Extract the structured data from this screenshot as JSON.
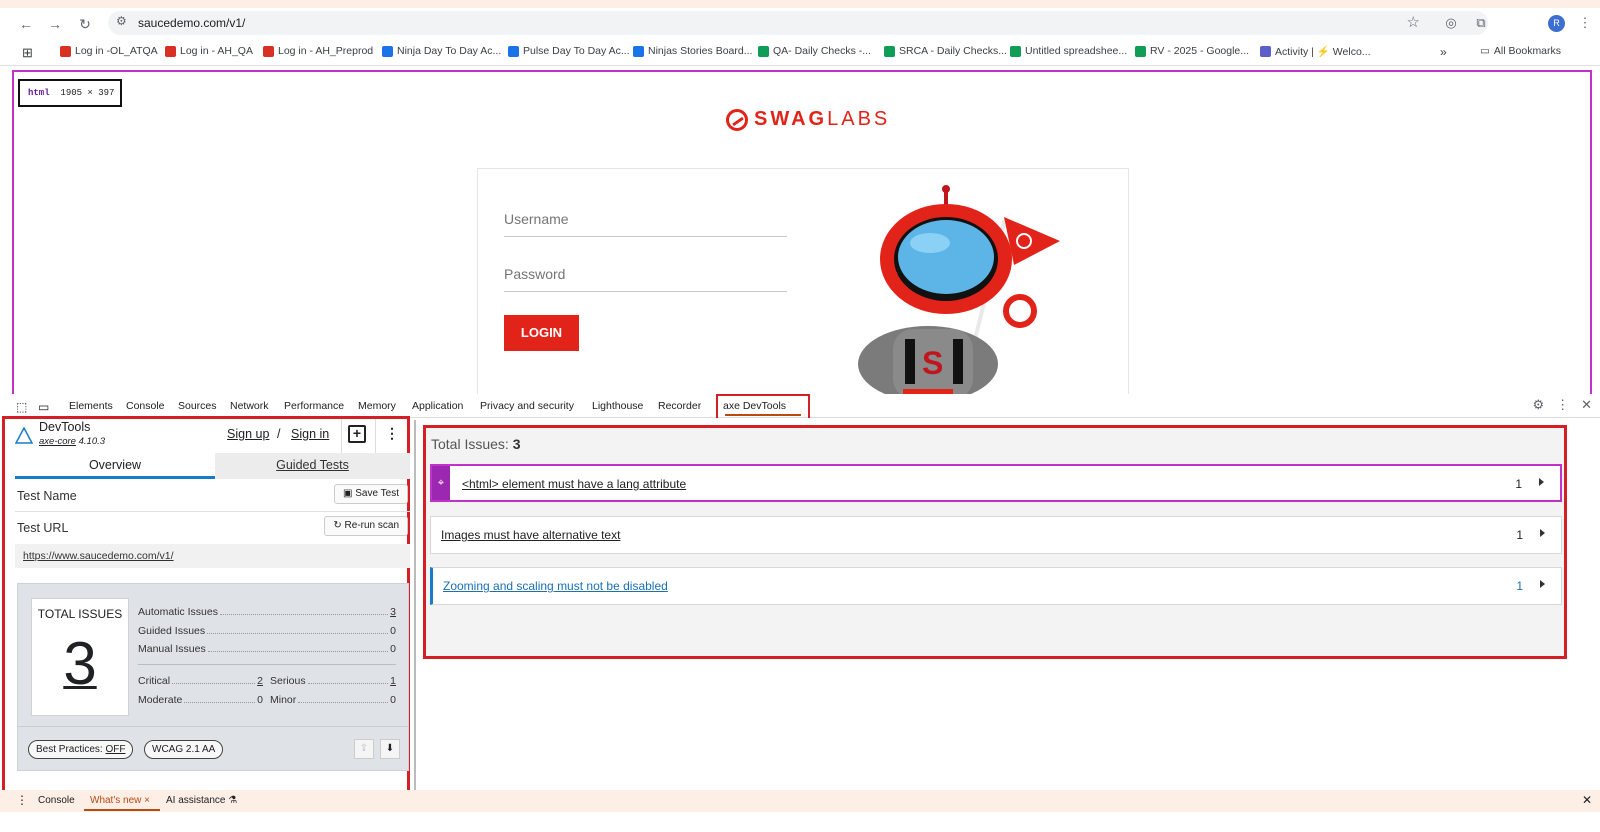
{
  "browser": {
    "url": "saucedemo.com/v1/",
    "avatar_letter": "R",
    "all_bookmarks": "All Bookmarks",
    "bookmarks": [
      {
        "label": "Log in -OL_ATQA",
        "color": "#d93025"
      },
      {
        "label": "Log in - AH_QA",
        "color": "#d93025"
      },
      {
        "label": "Log in - AH_Preprod",
        "color": "#d93025"
      },
      {
        "label": "Ninja Day To Day Ac...",
        "color": "#1a73e8"
      },
      {
        "label": "Pulse Day To Day Ac...",
        "color": "#1a73e8"
      },
      {
        "label": "Ninjas Stories Board...",
        "color": "#1a73e8"
      },
      {
        "label": "QA- Daily Checks -...",
        "color": "#0f9d58"
      },
      {
        "label": "SRCA - Daily Checks...",
        "color": "#0f9d58"
      },
      {
        "label": "Untitled spreadshee...",
        "color": "#0f9d58"
      },
      {
        "label": "RV - 2025 - Google...",
        "color": "#0f9d58"
      },
      {
        "label": "Activity | ⚡ Welco...",
        "color": "#5b5fc7"
      }
    ]
  },
  "page": {
    "badge_tag": "html",
    "badge_size": "1905 × 397",
    "logo_swag": "SWAG",
    "logo_labs": "LABS",
    "username_placeholder": "Username",
    "password_placeholder": "Password",
    "login_label": "LOGIN"
  },
  "devtools": {
    "tabs": [
      "Elements",
      "Console",
      "Sources",
      "Network",
      "Performance",
      "Memory",
      "Application",
      "Privacy and security",
      "Lighthouse",
      "Recorder",
      "axe DevTools"
    ],
    "bottom_tabs": [
      "Console",
      "What's new ×",
      "AI assistance ⚗"
    ]
  },
  "axe": {
    "product": "DevTools",
    "core_name": "axe-core",
    "core_version": "4.10.3",
    "sign_up": "Sign up",
    "slash": "/",
    "sign_in": "Sign in",
    "tab_overview": "Overview",
    "tab_guided": "Guided Tests",
    "test_name_label": "Test Name",
    "save_test": "Save Test",
    "test_url_label": "Test URL",
    "rerun_scan": "Re-run scan",
    "test_url": "https://www.saucedemo.com/v1/",
    "total_issues_title": "TOTAL ISSUES",
    "total_issues": "3",
    "stats": {
      "automatic_label": "Automatic Issues",
      "automatic": "3",
      "guided_label": "Guided Issues",
      "guided": "0",
      "manual_label": "Manual Issues",
      "manual": "0",
      "critical_label": "Critical",
      "critical": "2",
      "serious_label": "Serious",
      "serious": "1",
      "moderate_label": "Moderate",
      "moderate": "0",
      "minor_label": "Minor",
      "minor": "0"
    },
    "best_practices_label": "Best Practices:",
    "best_practices_value": "OFF",
    "wcag": "WCAG 2.1 AA",
    "results_label": "Total Issues:",
    "results_total": "3",
    "issues": [
      {
        "title": "<html> element must have a lang attribute",
        "count": "1"
      },
      {
        "title": "Images must have alternative text",
        "count": "1"
      },
      {
        "title": "Zooming and scaling must not be disabled",
        "count": "1"
      }
    ]
  }
}
